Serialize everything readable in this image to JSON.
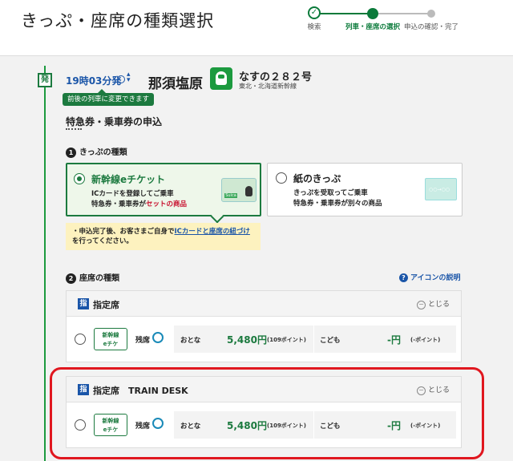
{
  "header": {
    "title": "きっぷ・座席の種類選択",
    "steps": [
      {
        "label": "検索",
        "mark": "✓"
      },
      {
        "label": "列車・座席の選択"
      },
      {
        "label": "申込の確認・完了"
      }
    ]
  },
  "train": {
    "departure_badge": "発",
    "departure_time": "19時03分発",
    "station": "那須塩原",
    "name": "なすの２８２号",
    "line": "東北・北海道新幹線",
    "tooltip": "前後の列車に変更できます"
  },
  "section": {
    "title": "特急券・乗車券の申込",
    "ticket_type_heading": "きっぷの種類",
    "seat_type_heading": "座席の種類",
    "num1": "1",
    "num2": "2"
  },
  "ticket_options": [
    {
      "title": "新幹線eチケット",
      "desc_line1": "ICカードを登録してご乗車",
      "desc_line2a": "特急券・乗車券が",
      "desc_line2b": "セットの商品",
      "selected": true,
      "image_text": "Suica"
    },
    {
      "title": "紙のきっぷ",
      "desc_line1": "きっぷを受取ってご乗車",
      "desc_line2a": "特急券・乗車券が別々の商品",
      "selected": false,
      "image_text": "○○→○○"
    }
  ],
  "notice": {
    "prefix": "・申込完了後、お客さまご自身で",
    "link": "ICカードと座席の紐づけ",
    "suffix": "を行ってください。"
  },
  "help_link": "アイコンの説明",
  "help_icon": "?",
  "seat_panels": [
    {
      "icon": "指",
      "name": "指定席",
      "close": "とじる",
      "etk_line1": "新幹線",
      "etk_line2": "eチケ",
      "avail_label": "残席",
      "adult_label": "おとな",
      "adult_price": "5,480円",
      "adult_points": "(109ポイント)",
      "child_label": "こども",
      "child_price": "-円",
      "child_points": "(-ポイント)"
    },
    {
      "icon": "指",
      "name": "指定席　TRAIN DESK",
      "close": "とじる",
      "etk_line1": "新幹線",
      "etk_line2": "eチケ",
      "avail_label": "残席",
      "adult_label": "おとな",
      "adult_price": "5,480円",
      "adult_points": "(109ポイント)",
      "child_label": "こども",
      "child_price": "-円",
      "child_points": "(-ポイント)"
    }
  ],
  "colors": {
    "brand_green": "#1c7a3f",
    "link_blue": "#1a55a8",
    "highlight_red": "#e0171f",
    "notice_yellow": "#fdf2bf"
  }
}
